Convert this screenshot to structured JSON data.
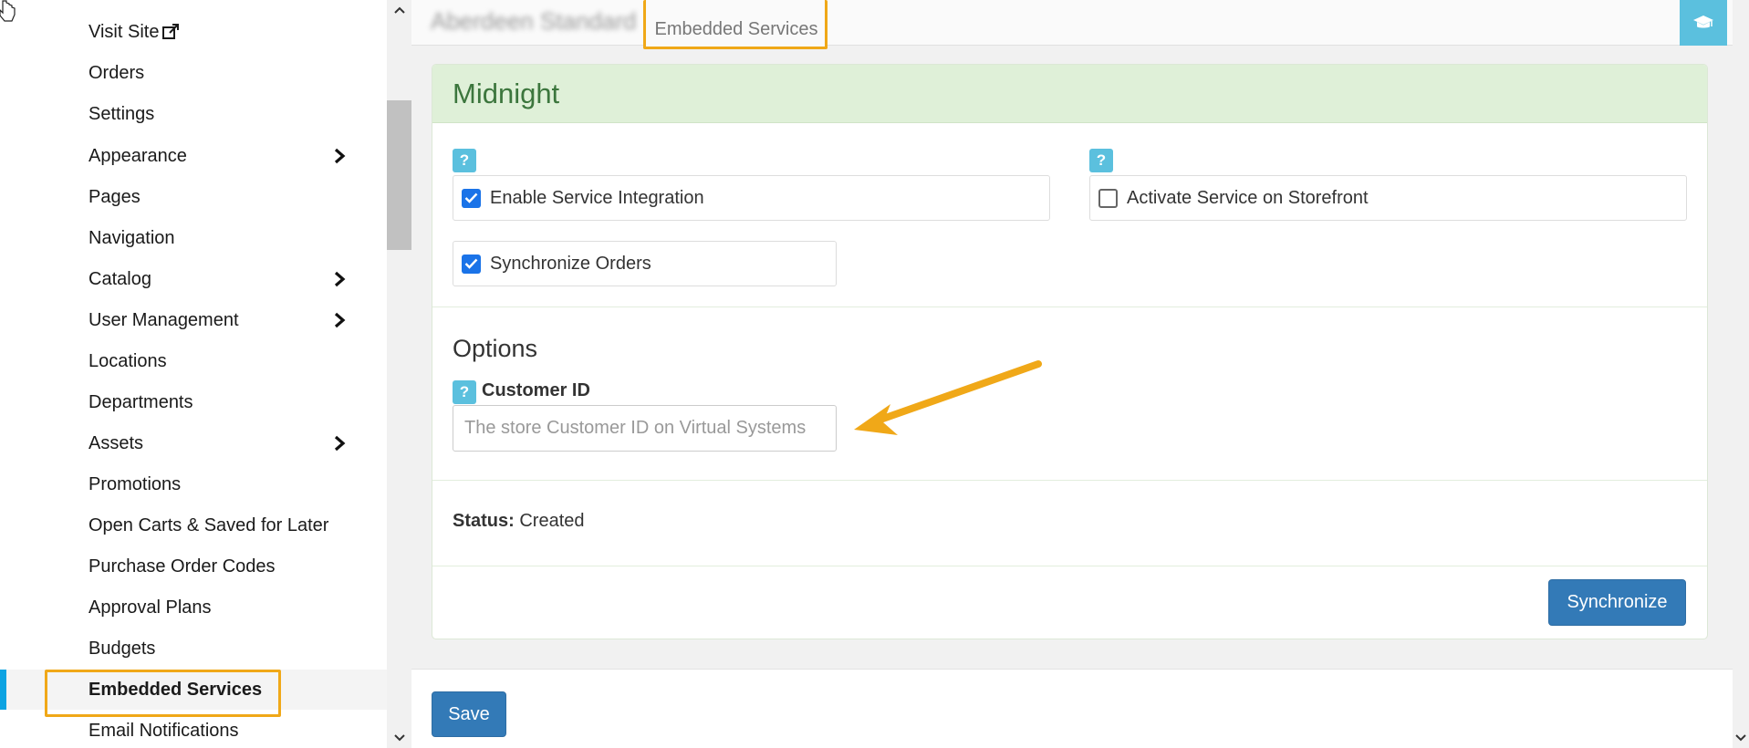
{
  "sidebar": {
    "visit_site": "Visit Site",
    "items": [
      {
        "label": "Visit Site",
        "has_chevron": false
      },
      {
        "label": "Orders",
        "has_chevron": false
      },
      {
        "label": "Settings",
        "has_chevron": false
      },
      {
        "label": "Appearance",
        "has_chevron": true
      },
      {
        "label": "Pages",
        "has_chevron": false
      },
      {
        "label": "Navigation",
        "has_chevron": false
      },
      {
        "label": "Catalog",
        "has_chevron": true
      },
      {
        "label": "User Management",
        "has_chevron": true
      },
      {
        "label": "Locations",
        "has_chevron": false
      },
      {
        "label": "Departments",
        "has_chevron": false
      },
      {
        "label": "Assets",
        "has_chevron": true
      },
      {
        "label": "Promotions",
        "has_chevron": false
      },
      {
        "label": "Open Carts & Saved for Later",
        "has_chevron": false
      },
      {
        "label": "Purchase Order Codes",
        "has_chevron": false
      },
      {
        "label": "Approval Plans",
        "has_chevron": false
      },
      {
        "label": "Budgets",
        "has_chevron": false
      },
      {
        "label": "Embedded Services",
        "has_chevron": false,
        "active": true
      },
      {
        "label": "Email Notifications",
        "has_chevron": false
      }
    ]
  },
  "header": {
    "store_name": "Aberdeen Standard",
    "breadcrumb_current": "Embedded Services",
    "help_icon": "graduation-cap-icon"
  },
  "panel": {
    "title": "Midnight",
    "help_mark": "?",
    "checkboxes": {
      "enable_integration": {
        "label": "Enable Service Integration",
        "checked": true
      },
      "activate_storefront": {
        "label": "Activate Service on Storefront",
        "checked": false
      },
      "sync_orders": {
        "label": "Synchronize Orders",
        "checked": true
      }
    },
    "options_title": "Options",
    "customer_id": {
      "label": "Customer ID",
      "value": "",
      "placeholder": "The store Customer ID on Virtual Systems"
    },
    "status": {
      "label": "Status:",
      "value": "Created"
    },
    "synchronize_label": "Synchronize"
  },
  "footer": {
    "save_label": "Save"
  },
  "colors": {
    "accent": "#337ab7",
    "success_header": "#dff0d8",
    "success_text": "#3c763d",
    "info": "#5bc0de",
    "highlight": "#f0a818",
    "active_marker": "#0da3e2",
    "checkbox_on": "#1a73e8"
  }
}
